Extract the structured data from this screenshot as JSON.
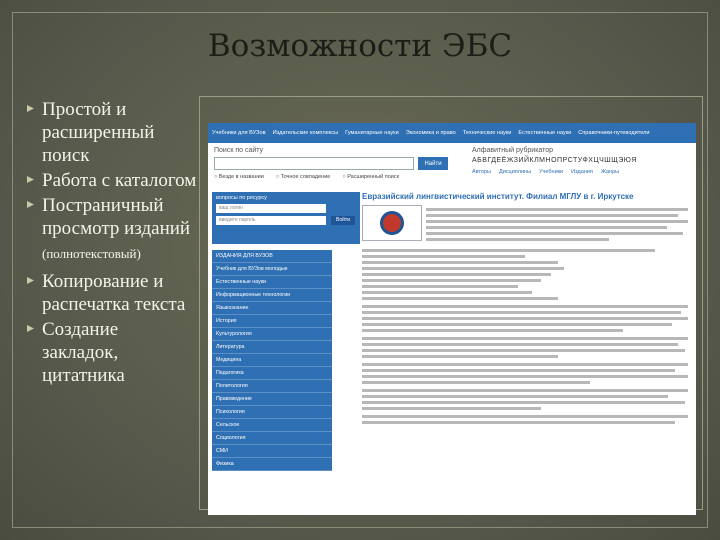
{
  "slide": {
    "title": "Возможности ЭБС",
    "bullets": [
      "Простой и расширенный поиск",
      "Работа с каталогом",
      "Постраничный просмотр изданий",
      "Копирование и распечатка текста",
      "Создание закладок, цитатника"
    ],
    "note": "(полнотекстовый)",
    "colors": {
      "background": "#5b5d47",
      "text": "#f4f4ea",
      "accent": "#2f6fb3"
    }
  },
  "screenshot": {
    "nav": [
      "Учебники для ВУЗов",
      "Издательские комплексы",
      "Гуманитарные науки",
      "Экономика и право",
      "Технические науки",
      "Естественные науки",
      "Справочники-путеводители"
    ],
    "search": {
      "title": "Поиск по сайту",
      "button": "Найти",
      "options": [
        "Везде в названии",
        "Точное совпадение",
        "Расширенный поиск"
      ]
    },
    "rubricator": {
      "title": "Алфавитный рубрикатор",
      "letters": "АБВГДЕЁЖЗИЙКЛМНОПРСТУФХЦЧШЩЭЮЯ",
      "links": [
        "Авторы",
        "Дисциплины",
        "Учебники",
        "Издания",
        "Жанры"
      ]
    },
    "login": {
      "title": "вопросы по ресурсу",
      "login_placeholder": "ваш логин",
      "password_placeholder": "введите пароль",
      "button": "Войти"
    },
    "menu": [
      "ИЗДАНИЯ ДЛЯ ВУЗОВ",
      "Учебник для ВУЗов молодые",
      "Естественные науки",
      "Информационные технологии",
      "Языкознание",
      "История",
      "Культурология",
      "Литература",
      "Медицина",
      "Педагогика",
      "Политология",
      "Правоведение",
      "Психология",
      "Сельское",
      "Социология",
      "СМИ",
      "Физика"
    ],
    "content_title": "Евразийский лингвистический институт. Филиал МГЛУ в г. Иркутске"
  }
}
